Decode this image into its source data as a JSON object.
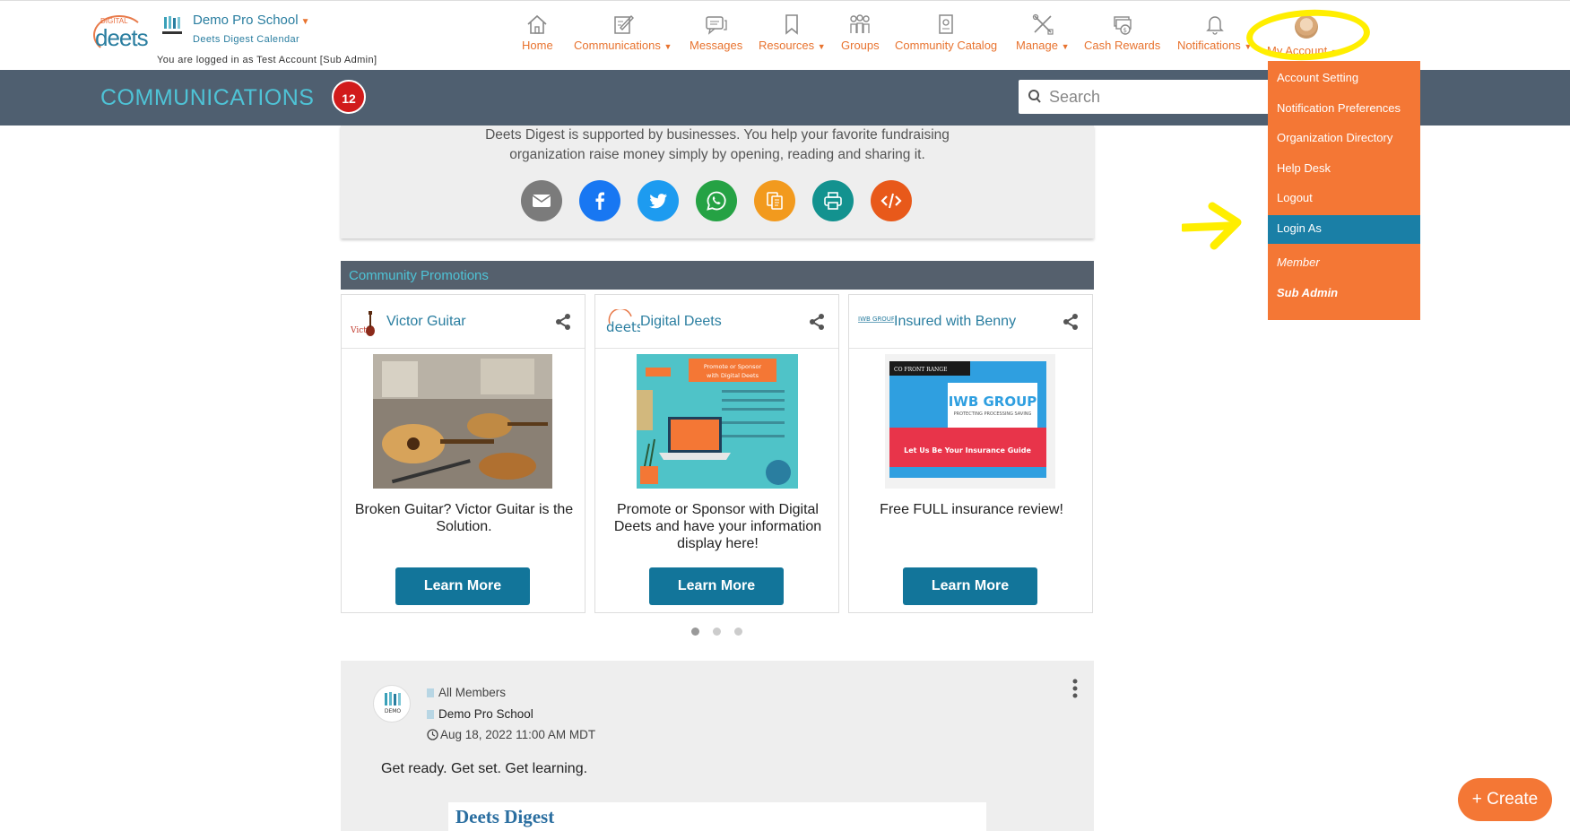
{
  "header": {
    "logo_small": "DIGITAL",
    "logo_big": "deets",
    "school_name": "Demo Pro School",
    "school_sub": "Deets Digest Calendar",
    "logged_in_text": "You are logged in as Test Account [Sub Admin]"
  },
  "nav": [
    {
      "label": "Home",
      "icon": "home-icon"
    },
    {
      "label": "Communications",
      "icon": "edit-icon",
      "caret": true
    },
    {
      "label": "Messages",
      "icon": "chat-icon"
    },
    {
      "label": "Resources",
      "icon": "bookmark-icon",
      "caret": true
    },
    {
      "label": "Groups",
      "icon": "people-icon"
    },
    {
      "label": "Community Catalog",
      "icon": "catalog-icon"
    },
    {
      "label": "Manage",
      "icon": "tools-icon",
      "caret": true
    },
    {
      "label": "Cash Rewards",
      "icon": "money-icon"
    },
    {
      "label": "Notifications",
      "icon": "bell-icon",
      "caret": true
    },
    {
      "label": "My Account",
      "icon": "avatar",
      "caret": true
    }
  ],
  "band": {
    "title": "COMMUNICATIONS",
    "badge": "12",
    "search_placeholder": "Search"
  },
  "dropdown": {
    "items": [
      "Account Setting",
      "Notification Preferences",
      "Organization Directory",
      "Help Desk",
      "Logout",
      "Login As"
    ],
    "active": "Login As",
    "roles": [
      "Member",
      "Sub Admin"
    ]
  },
  "share": {
    "text_line1": "Deets Digest is supported by businesses. You help your favorite fundraising",
    "text_line2": "organization raise money simply by opening, reading and sharing it.",
    "buttons": [
      "email-icon",
      "facebook-icon",
      "twitter-icon",
      "whatsapp-icon",
      "copy-icon",
      "print-icon",
      "embed-icon"
    ]
  },
  "promotions": {
    "title": "Community Promotions",
    "cards": [
      {
        "brand": "Victor Guitar",
        "desc": "Broken Guitar? Victor Guitar is the Solution.",
        "button": "Learn More"
      },
      {
        "brand": "Digital Deets",
        "desc": "Promote or Sponsor with Digital Deets and have your information display here!",
        "button": "Learn More"
      },
      {
        "brand": "Insured with Benny",
        "desc": "Free FULL insurance review!",
        "button": "Learn More"
      }
    ],
    "card2_img": {
      "line1": "Promote or Sponsor",
      "line2": "with Digital Deets"
    },
    "card3_img": {
      "tag": "CO FRONT RANGE",
      "company": "IWB GROUP",
      "tagline": "PROTECTING PROCESSING SAVING",
      "banner": "Let Us Be Your Insurance Guide"
    },
    "card1_logo": "Vict",
    "card3_logo": "IWB GROUP"
  },
  "post": {
    "audience": "All Members",
    "school": "Demo Pro School",
    "date": "Aug 18, 2022 11:00 AM MDT",
    "body": "Get ready. Get set. Get learning.",
    "banner": "Deets Digest",
    "avatar_text": "DEMO"
  },
  "create_button": "+ Create",
  "colors": {
    "accent_orange": "#f47735",
    "link_blue": "#2a7ea0",
    "band": "#4f5f70",
    "active_blue": "#1a7fa6",
    "highlight": "#ffee00"
  }
}
